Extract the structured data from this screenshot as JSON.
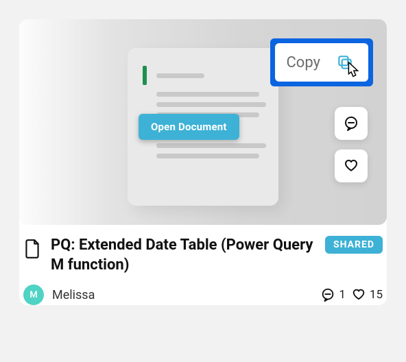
{
  "card": {
    "title": "PQ: Extended Date Table (Power Query M function)",
    "badge": "SHARED",
    "open_label": "Open Document",
    "copy_label": "Copy",
    "author": {
      "name": "Melissa",
      "initial": "M"
    },
    "stats": {
      "comments": "1",
      "likes": "15"
    }
  }
}
